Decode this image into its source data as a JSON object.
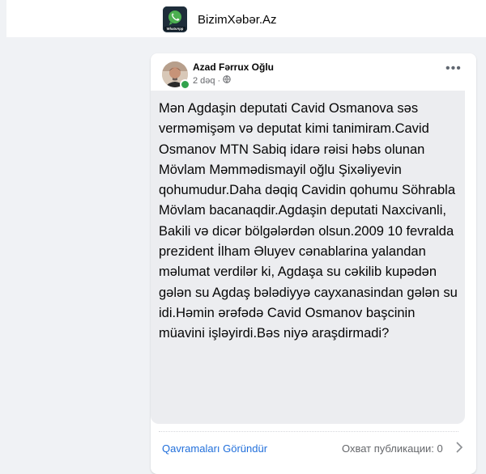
{
  "page": {
    "name": "BizimXəbər.Az",
    "logo_text": "WhatsApp"
  },
  "post": {
    "author": "Azad Fərrux Oğlu",
    "time": "2 dəq",
    "privacy_icon": "globe-icon",
    "more_icon": "more-horizontal-icon",
    "text": "Mən Agdaşin deputati Cavid Osmanova səs verməmişəm və deputat kimi tanimiram.Cavid Osmanov MTN Sabiq idarə rəisi həbs olunan Mövlam Məmmədismayil oğlu Şixəliyevin qohumudur.Daha dəqiq Cavidin qohumu Söhrabla Mövlam bacanaqdir.Agdaşin deputati Naxcivanli, Bakili və dicər bölgələrdən olsun.2009 10 fevralda prezident İlham Əluyev cənablarina yalandan məlumat verdilər ki, Agdaşa su cəkilib kupədən gələn su Agdaş bələdiyyə cayxanasindan gələn su idi.Həmin ərəfədə Cavid Osmanov başcinin müavini işləyirdi.Bəs niyə araşdirmadi?"
  },
  "footer": {
    "translate_label": "Qavramaları Göründür",
    "rate_label": "Охват публикации: 0"
  },
  "colors": {
    "link": "#216fdb",
    "online": "#31a24c",
    "post_bg": "#ecedf0"
  }
}
